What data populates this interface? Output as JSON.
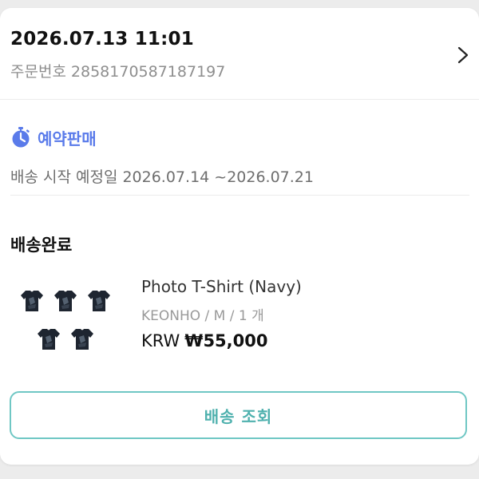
{
  "order": {
    "datetime": "2026.07.13 11:01",
    "number_label": "주문번호",
    "number": "2858170587187197"
  },
  "preorder": {
    "icon": "stopwatch-icon",
    "label": "예약판매",
    "schedule_label": "배송 시작 예정일",
    "schedule_dates": "2026.07.14 ~2026.07.21"
  },
  "shipment": {
    "status": "배송완료",
    "product": {
      "name": "Photo T-Shirt (Navy)",
      "option": "KEONHO / M / 1 개",
      "currency": "KRW",
      "price": "₩55,000"
    },
    "track_button_label": "배송 조회"
  },
  "colors": {
    "accent_blue": "#5a7bea",
    "button_teal": "#6fc7c4",
    "shirt_navy": "#1e2530"
  }
}
